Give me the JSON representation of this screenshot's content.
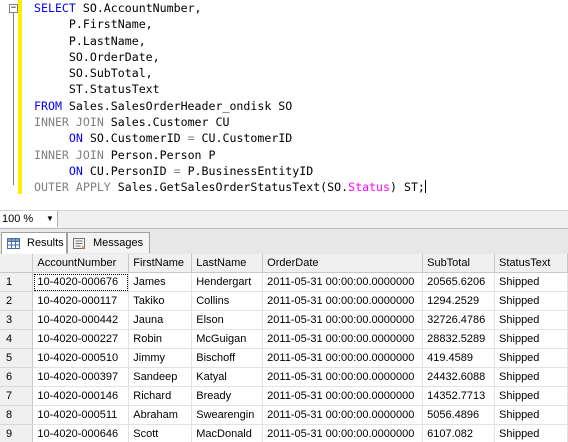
{
  "editor": {
    "collapse_glyph": "−",
    "lines": [
      [
        {
          "t": "SELECT",
          "c": "kw"
        },
        {
          "t": " SO.AccountNumber,"
        }
      ],
      [
        {
          "t": "     P.FirstName,"
        }
      ],
      [
        {
          "t": "     P.LastName,"
        }
      ],
      [
        {
          "t": "     SO.OrderDate,"
        }
      ],
      [
        {
          "t": "     SO.SubTotal,"
        }
      ],
      [
        {
          "t": "     ST.StatusText"
        }
      ],
      [
        {
          "t": "FROM",
          "c": "kw"
        },
        {
          "t": " Sales.SalesOrderHeader_ondisk SO"
        }
      ],
      [
        {
          "t": "INNER JOIN",
          "c": "kw2"
        },
        {
          "t": " Sales.Customer CU"
        }
      ],
      [
        {
          "t": "     "
        },
        {
          "t": "ON",
          "c": "kw"
        },
        {
          "t": " SO.CustomerID "
        },
        {
          "t": "=",
          "c": "kw2"
        },
        {
          "t": " CU.CustomerID"
        }
      ],
      [
        {
          "t": "INNER JOIN",
          "c": "kw2"
        },
        {
          "t": " Person.Person P"
        }
      ],
      [
        {
          "t": "     "
        },
        {
          "t": "ON",
          "c": "kw"
        },
        {
          "t": " CU.PersonID "
        },
        {
          "t": "=",
          "c": "kw2"
        },
        {
          "t": " P.BusinessEntityID"
        }
      ],
      [
        {
          "t": "OUTER APPLY",
          "c": "kw2"
        },
        {
          "t": " Sales.GetSalesOrderStatusText(SO."
        },
        {
          "t": "Status",
          "c": "fn"
        },
        {
          "t": ") ST;"
        }
      ]
    ]
  },
  "zoom": {
    "value": "100 %",
    "dropdown_icon": "chevron-down-icon"
  },
  "tabs": [
    {
      "label": "Results",
      "icon": "grid-icon",
      "active": true
    },
    {
      "label": "Messages",
      "icon": "messages-icon",
      "active": false
    }
  ],
  "results": {
    "columns": [
      "AccountNumber",
      "FirstName",
      "LastName",
      "OrderDate",
      "SubTotal",
      "StatusText"
    ],
    "rows": [
      {
        "n": "1",
        "cells": [
          "10-4020-000676",
          "James",
          "Hendergart",
          "2011-05-31 00:00:00.0000000",
          "20565.6206",
          "Shipped"
        ]
      },
      {
        "n": "2",
        "cells": [
          "10-4020-000117",
          "Takiko",
          "Collins",
          "2011-05-31 00:00:00.0000000",
          "1294.2529",
          "Shipped"
        ]
      },
      {
        "n": "3",
        "cells": [
          "10-4020-000442",
          "Jauna",
          "Elson",
          "2011-05-31 00:00:00.0000000",
          "32726.4786",
          "Shipped"
        ]
      },
      {
        "n": "4",
        "cells": [
          "10-4020-000227",
          "Robin",
          "McGuigan",
          "2011-05-31 00:00:00.0000000",
          "28832.5289",
          "Shipped"
        ]
      },
      {
        "n": "5",
        "cells": [
          "10-4020-000510",
          "Jimmy",
          "Bischoff",
          "2011-05-31 00:00:00.0000000",
          "419.4589",
          "Shipped"
        ]
      },
      {
        "n": "6",
        "cells": [
          "10-4020-000397",
          "Sandeep",
          "Katyal",
          "2011-05-31 00:00:00.0000000",
          "24432.6088",
          "Shipped"
        ]
      },
      {
        "n": "7",
        "cells": [
          "10-4020-000146",
          "Richard",
          "Bready",
          "2011-05-31 00:00:00.0000000",
          "14352.7713",
          "Shipped"
        ]
      },
      {
        "n": "8",
        "cells": [
          "10-4020-000511",
          "Abraham",
          "Swearengin",
          "2011-05-31 00:00:00.0000000",
          "5056.4896",
          "Shipped"
        ]
      },
      {
        "n": "9",
        "cells": [
          "10-4020-000646",
          "Scott",
          "MacDonald",
          "2011-05-31 00:00:00.0000000",
          "6107.082",
          "Shipped"
        ]
      }
    ]
  }
}
